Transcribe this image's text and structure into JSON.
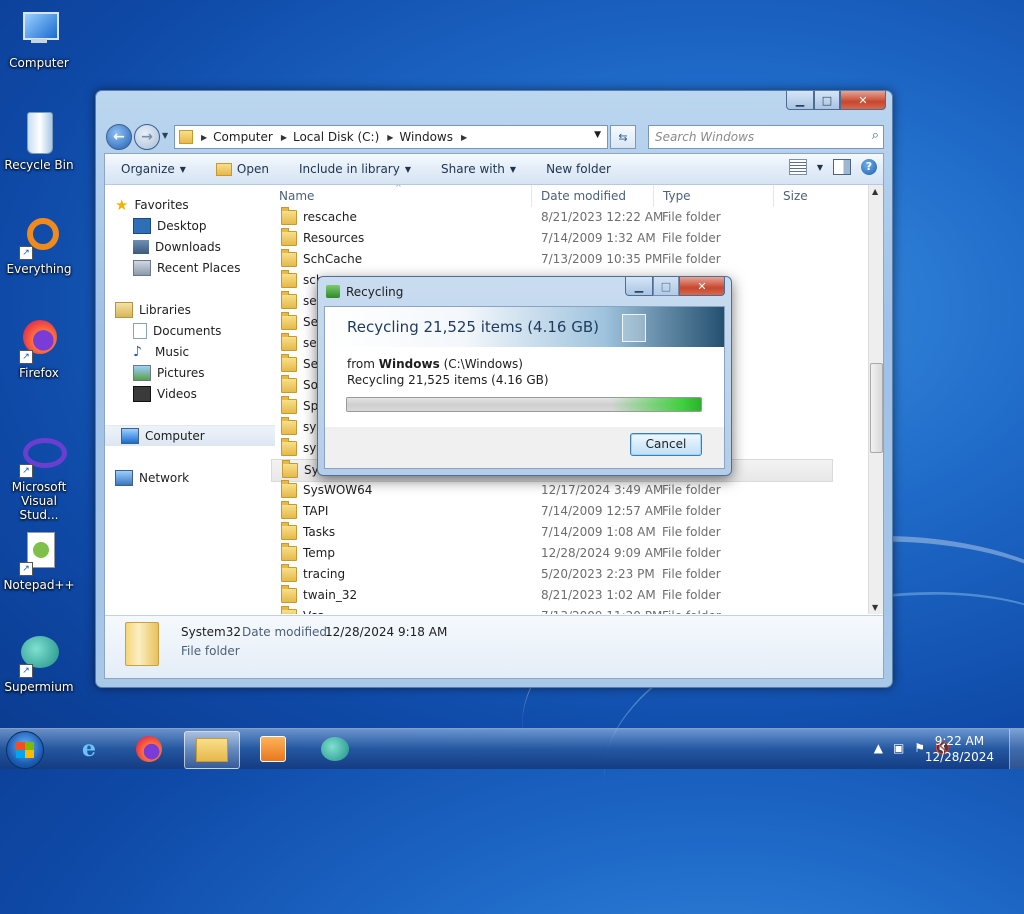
{
  "desktop": {
    "icons": [
      {
        "label": "Computer"
      },
      {
        "label": "Recycle Bin"
      },
      {
        "label": "Everything"
      },
      {
        "label": "Firefox"
      },
      {
        "label": "Microsoft Visual Stud..."
      },
      {
        "label": "Notepad++"
      },
      {
        "label": "Supermium"
      }
    ]
  },
  "explorer": {
    "address": {
      "crumbs": [
        "Computer",
        "Local Disk (C:)",
        "Windows"
      ]
    },
    "search": {
      "placeholder": "Search Windows"
    },
    "toolbar": {
      "organize": "Organize",
      "open": "Open",
      "include": "Include in library",
      "share": "Share with",
      "newfolder": "New folder"
    },
    "nav": {
      "favorites": "Favorites",
      "desktop": "Desktop",
      "downloads": "Downloads",
      "recent": "Recent Places",
      "libraries": "Libraries",
      "documents": "Documents",
      "music": "Music",
      "pictures": "Pictures",
      "videos": "Videos",
      "computer": "Computer",
      "network": "Network"
    },
    "columns": {
      "name": "Name",
      "date": "Date modified",
      "type": "Type",
      "size": "Size"
    },
    "rows": [
      {
        "name": "rescache",
        "date": "8/21/2023 12:22 AM",
        "type": "File folder"
      },
      {
        "name": "Resources",
        "date": "7/14/2009 1:32 AM",
        "type": "File folder"
      },
      {
        "name": "SchCache",
        "date": "7/13/2009 10:35 PM",
        "type": "File folder"
      },
      {
        "name": "sch",
        "date": "",
        "type": ""
      },
      {
        "name": "sec",
        "date": "",
        "type": ""
      },
      {
        "name": "Ser",
        "date": "",
        "type": ""
      },
      {
        "name": "ser",
        "date": "",
        "type": ""
      },
      {
        "name": "Set",
        "date": "",
        "type": ""
      },
      {
        "name": "Sof",
        "date": "",
        "type": ""
      },
      {
        "name": "Spe",
        "date": "",
        "type": ""
      },
      {
        "name": "syn",
        "date": "",
        "type": ""
      },
      {
        "name": "sys",
        "date": "",
        "type": ""
      },
      {
        "name": "Sys",
        "date": "",
        "type": ""
      },
      {
        "name": "SysWOW64",
        "date": "12/17/2024 3:49 AM",
        "type": "File folder"
      },
      {
        "name": "TAPI",
        "date": "7/14/2009 12:57 AM",
        "type": "File folder"
      },
      {
        "name": "Tasks",
        "date": "7/14/2009 1:08 AM",
        "type": "File folder"
      },
      {
        "name": "Temp",
        "date": "12/28/2024 9:09 AM",
        "type": "File folder"
      },
      {
        "name": "tracing",
        "date": "5/20/2023 2:23 PM",
        "type": "File folder"
      },
      {
        "name": "twain_32",
        "date": "8/21/2023 1:02 AM",
        "type": "File folder"
      },
      {
        "name": "Vss",
        "date": "7/13/2009 11:20 PM",
        "type": "File folder"
      }
    ],
    "details": {
      "name": "System32",
      "modified_label": "Date modified:",
      "modified_value": "12/28/2024 9:18 AM",
      "type": "File folder"
    }
  },
  "dialog": {
    "title": "Recycling",
    "banner": "Recycling 21,525 items (4.16 GB)",
    "from_prefix": "from",
    "from_bold": "Windows",
    "from_path": "(C:\\Windows)",
    "status": "Recycling 21,525 items (4.16 GB)",
    "progress": 1.0,
    "cancel": "Cancel"
  },
  "taskbar": {
    "time": "9:22 AM",
    "date": "12/28/2024"
  }
}
